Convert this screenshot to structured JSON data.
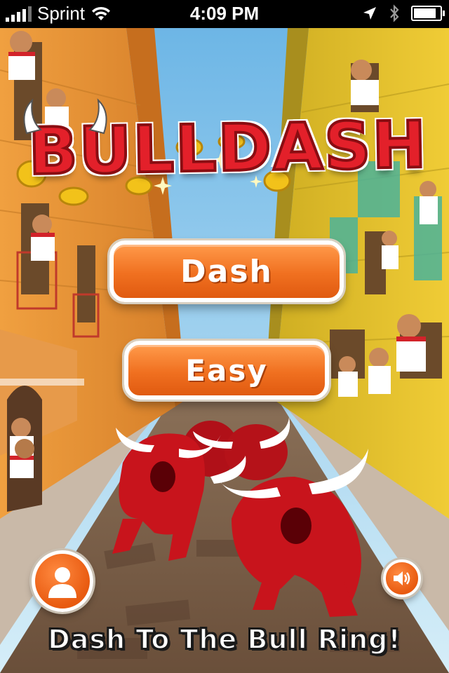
{
  "status_bar": {
    "carrier": "Sprint",
    "time": "4:09 PM",
    "battery_fraction": 0.9
  },
  "game": {
    "logo_text": "BULLDASH",
    "menu": {
      "dash_label": "Dash",
      "easy_label": "Easy"
    },
    "profile_icon": "person-icon",
    "sound_icon": "speaker-icon",
    "tagline": "Dash To The Bull Ring!"
  },
  "colors": {
    "button_orange": "#f07020",
    "logo_red": "#e3202a",
    "sky_blue": "#8ec8ea",
    "left_building": "#e8962a",
    "right_building": "#e6c12e",
    "bull_red": "#c8141c"
  }
}
